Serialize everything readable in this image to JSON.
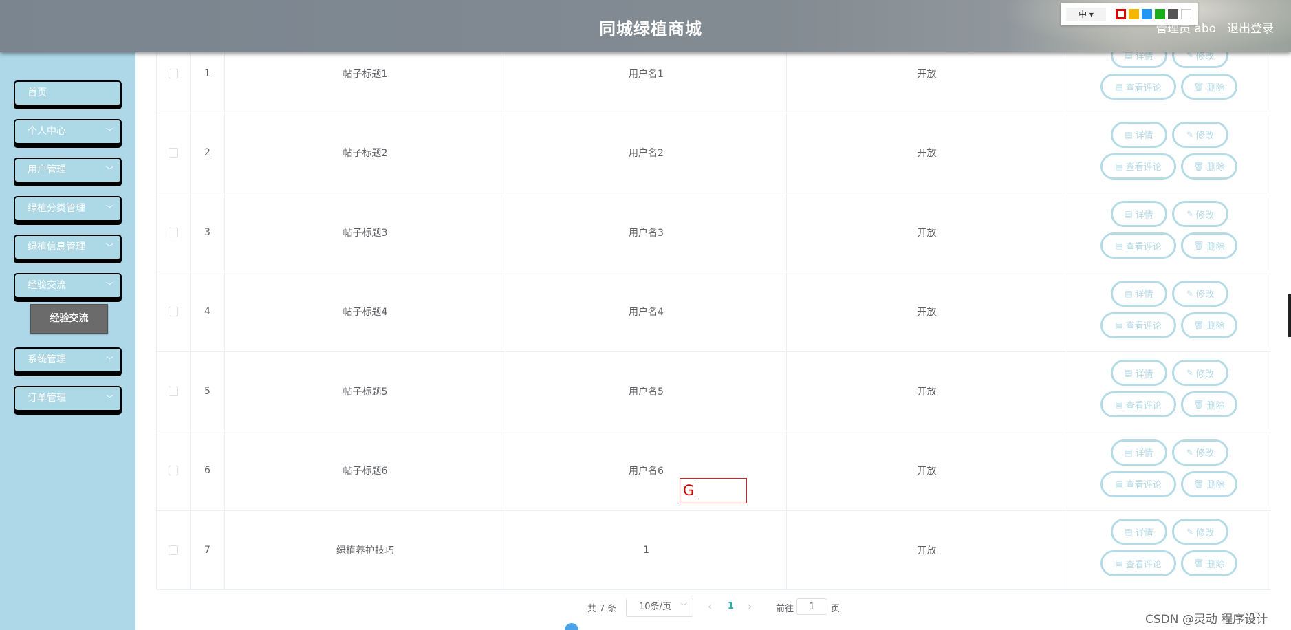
{
  "header": {
    "title": "同城绿植商城",
    "admin_label": "管理员 abo",
    "logout_label": "退出登录",
    "lang_label": "中 ▾",
    "theme_colors": [
      "#e60000",
      "#f5b800",
      "#2196f3",
      "#1aad19",
      "#555555",
      "#ffffff"
    ]
  },
  "sidebar": {
    "items": [
      {
        "label": "首页",
        "has_children": false
      },
      {
        "label": "个人中心",
        "has_children": true
      },
      {
        "label": "用户管理",
        "has_children": true
      },
      {
        "label": "绿植分类管理",
        "has_children": true
      },
      {
        "label": "绿植信息管理",
        "has_children": true
      },
      {
        "label": "经验交流",
        "has_children": true
      },
      {
        "label": "系统管理",
        "has_children": true
      },
      {
        "label": "订单管理",
        "has_children": true
      }
    ],
    "active_submenu": "经验交流"
  },
  "table": {
    "rows": [
      {
        "index": "1",
        "title": "帖子标题1",
        "username": "用户名1",
        "status": "开放"
      },
      {
        "index": "2",
        "title": "帖子标题2",
        "username": "用户名2",
        "status": "开放"
      },
      {
        "index": "3",
        "title": "帖子标题3",
        "username": "用户名3",
        "status": "开放"
      },
      {
        "index": "4",
        "title": "帖子标题4",
        "username": "用户名4",
        "status": "开放"
      },
      {
        "index": "5",
        "title": "帖子标题5",
        "username": "用户名5",
        "status": "开放"
      },
      {
        "index": "6",
        "title": "帖子标题6",
        "username": "用户名6",
        "status": "开放"
      },
      {
        "index": "7",
        "title": "绿植养护技巧",
        "username": "1",
        "status": "开放"
      }
    ],
    "actions": {
      "detail": "详情",
      "edit": "修改",
      "comments": "查看评论",
      "delete": "删除"
    }
  },
  "pagination": {
    "total": "共 7 条",
    "page_size": "10条/页",
    "current_page": "1",
    "goto_label": "前往",
    "goto_value": "1",
    "page_suffix": "页"
  },
  "overlay": {
    "text": "G"
  },
  "watermark": "CSDN @灵动 程序设计"
}
